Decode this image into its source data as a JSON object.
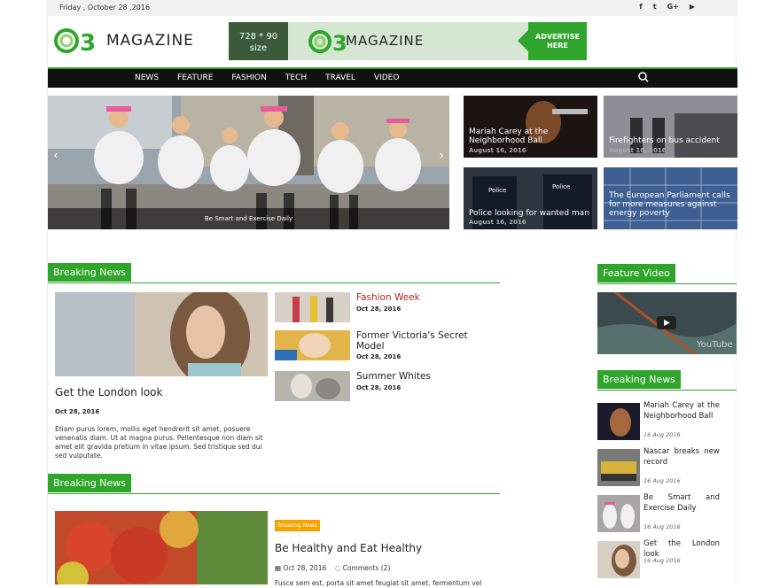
{
  "topbar": {
    "date": "Friday , October 28 ,2016"
  },
  "social": [
    {
      "icon": "facebook-icon",
      "glyph": "f"
    },
    {
      "icon": "twitter-icon",
      "glyph": "t"
    },
    {
      "icon": "google-plus-icon",
      "glyph": "G+"
    },
    {
      "icon": "youtube-icon",
      "glyph": "▶"
    }
  ],
  "logo": {
    "text": "MAGAZINE"
  },
  "ad": {
    "size": "728 * 90\nsize",
    "logo_text": "MAGAZINE",
    "button": "ADVERTISE\nHERE"
  },
  "nav": {
    "items": [
      "NEWS",
      "FEATURE",
      "FASHION",
      "TECH",
      "TRAVEL",
      "VIDEO"
    ]
  },
  "hero": {
    "caption": "Be Smart and Exercise Daily"
  },
  "thumbs": [
    {
      "title": "Mariah Carey at the Neighborhood Ball",
      "date": "August 16, 2016"
    },
    {
      "title": "Firefighters on bus accident",
      "date": "August 16, 2016"
    },
    {
      "title": "Police looking for wanted man",
      "date": "August 16, 2016"
    },
    {
      "title": "The European Parliament calls for more measures against energy poverty",
      "date": ""
    }
  ],
  "breaking1": {
    "heading": "Breaking News",
    "main_title": "Get the London look",
    "main_date": "Oct 28, 2016",
    "main_excerpt": "Etiam purus lorem, mollis eget hendrerit sit amet, posuere venenatis diam. Ut at magna purus. Pellentesque non diam sit amet elit gravida pretium in vitae ipsum. Sed tristique sed dui sed vulputate.",
    "items": [
      {
        "title": "Fashion Week",
        "date": "Oct 28, 2016"
      },
      {
        "title": "Former Victoria's Secret Model",
        "date": "Oct 28, 2016"
      },
      {
        "title": "Summer Whites",
        "date": "Oct 28, 2016"
      }
    ]
  },
  "breaking2": {
    "heading": "Breaking News",
    "tag": "Breaking News",
    "title": "Be Healthy and Eat Healthy",
    "date": "Oct 28, 2016",
    "comments": "Comments (2)",
    "excerpt": "Fusce sem est, porta sit amet feugiat sit amet, fermentum vel"
  },
  "feature_video": {
    "heading": "Feature Video"
  },
  "side_breaking": {
    "heading": "Breaking News",
    "items": [
      {
        "title": "Mariah Carey at the Neighborhood Ball",
        "date": "16 Aug 2016"
      },
      {
        "title": "Nascar breaks new record",
        "date": "16 Aug 2016"
      },
      {
        "title": "Be Smart and Exercise Daily",
        "date": "16 Aug 2016"
      },
      {
        "title": "Get the London look",
        "date": "16 Aug 2016"
      }
    ]
  },
  "colors": {
    "accent": "#2fa52b",
    "nav_bg": "#111111",
    "link_red": "#b32020",
    "tag": "#f5a300"
  }
}
